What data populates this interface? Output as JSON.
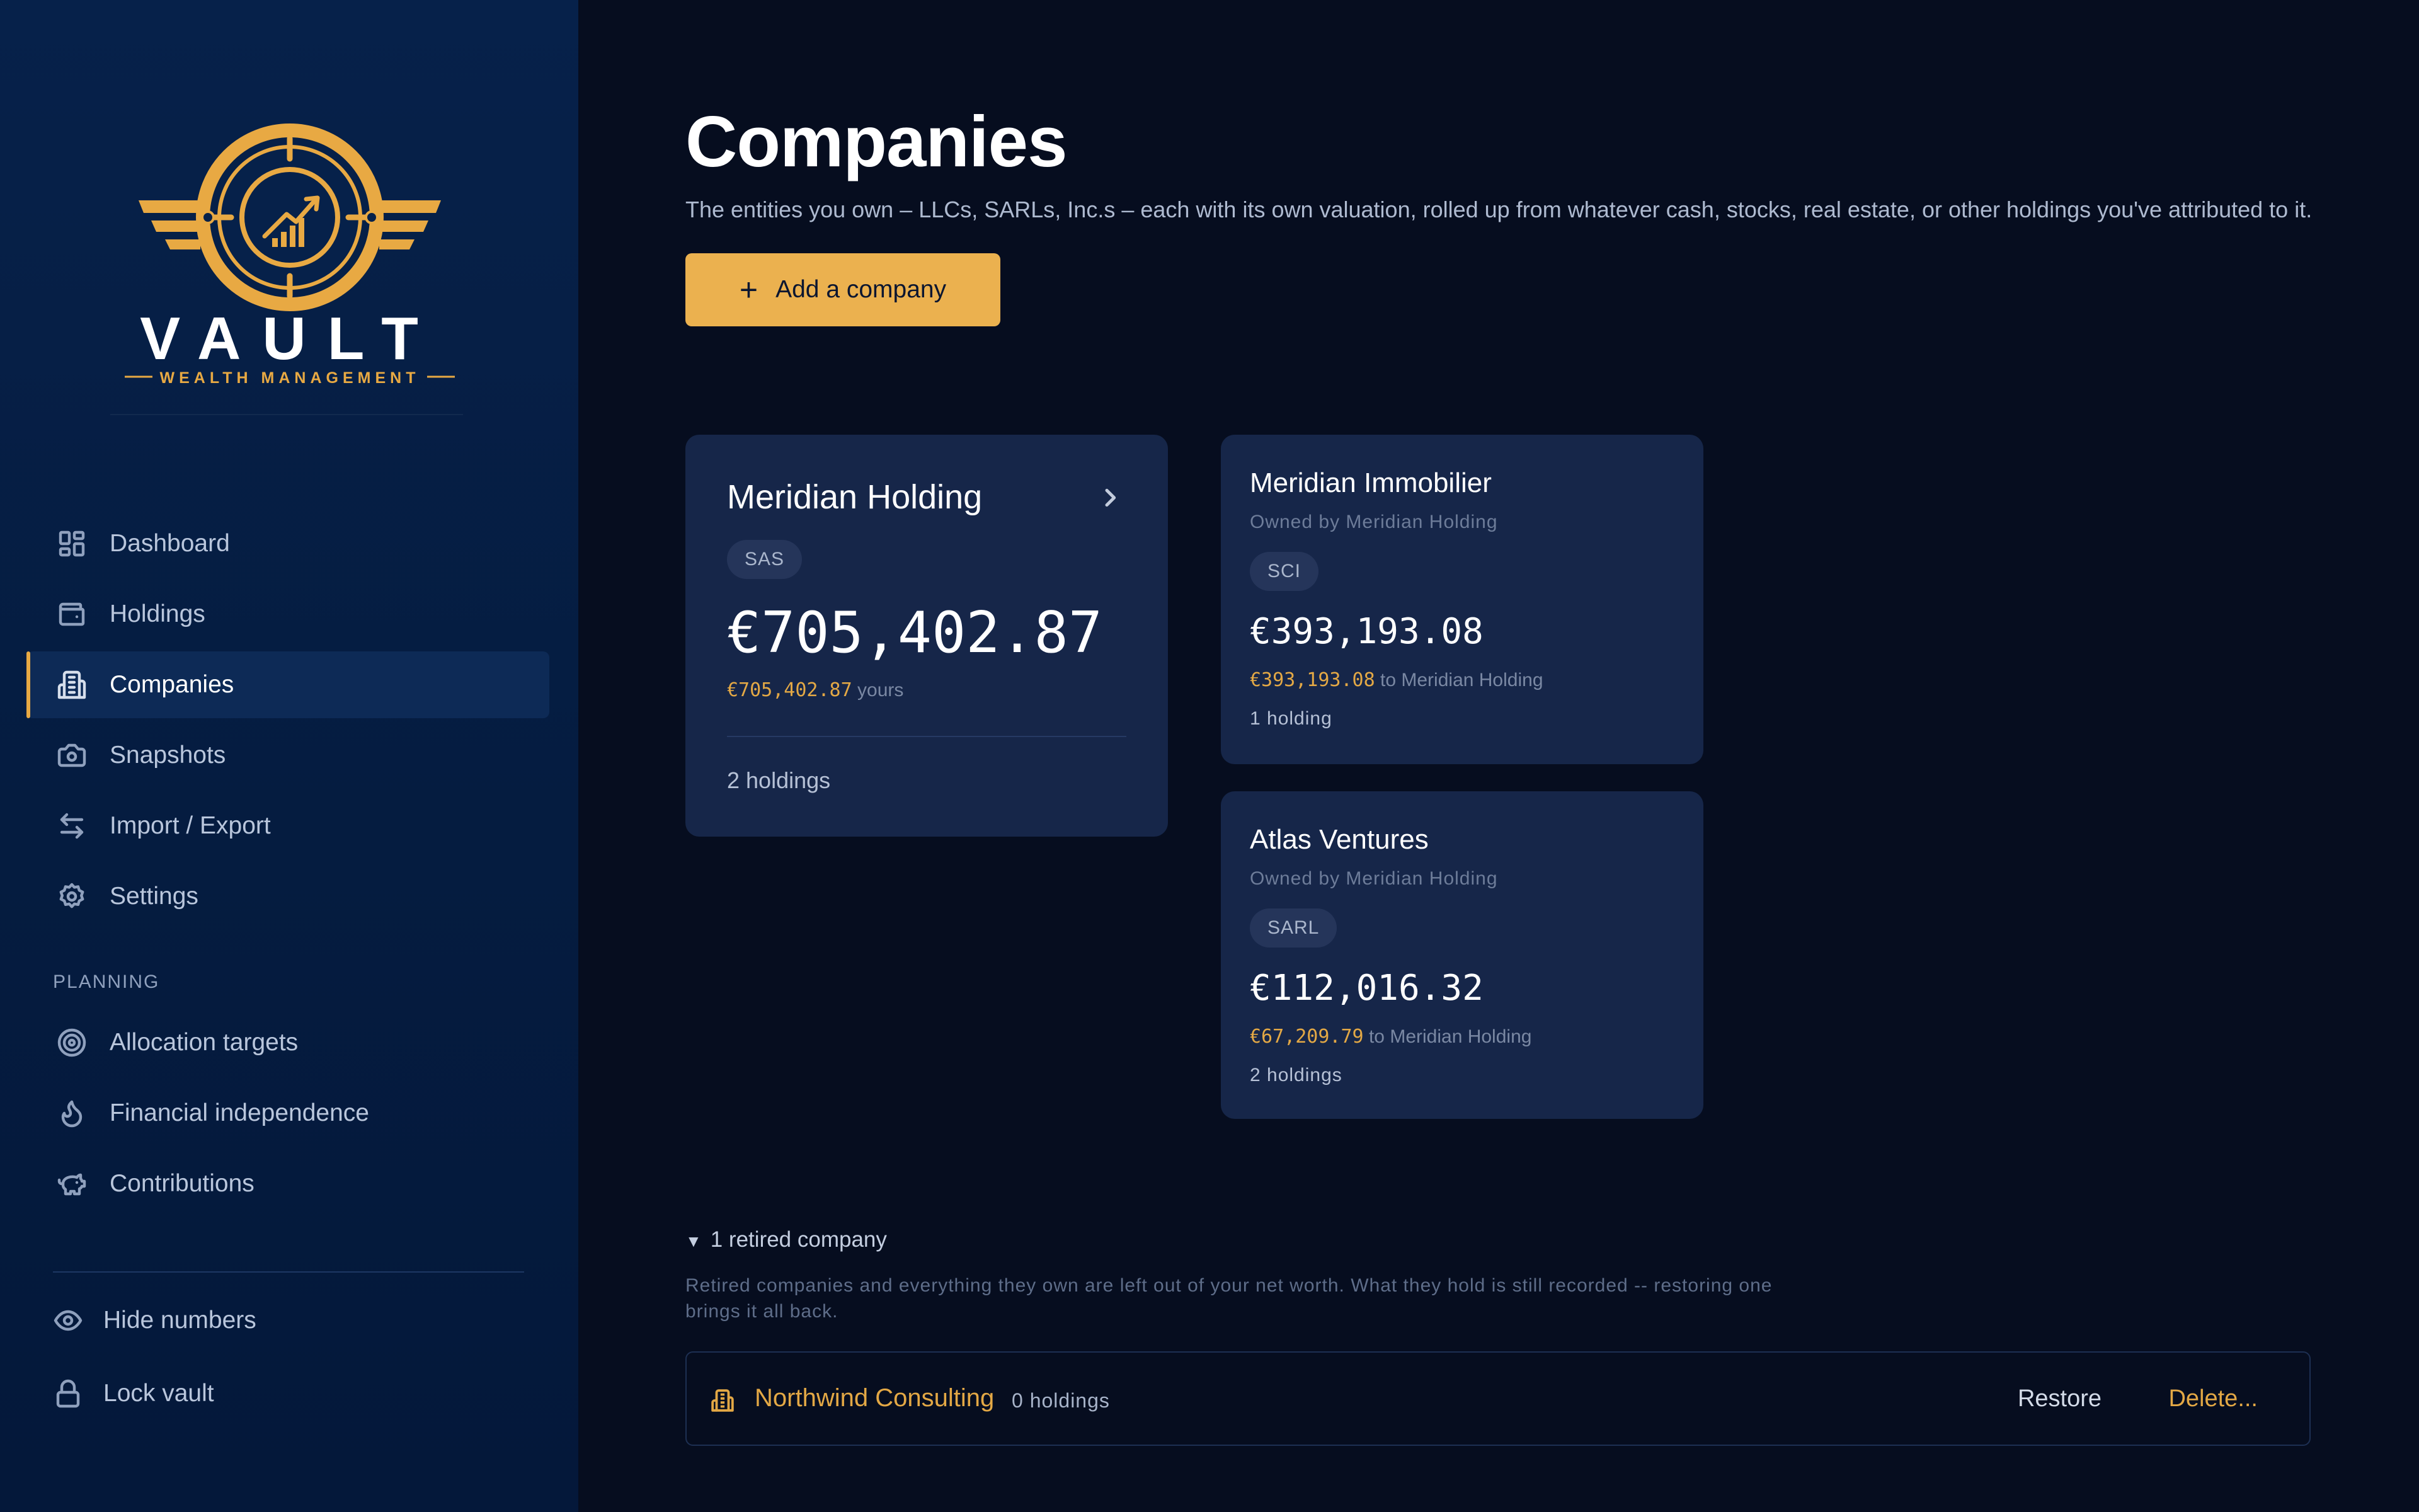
{
  "brand": {
    "name": "VAULT",
    "tagline": "WEALTH MANAGEMENT",
    "accent_color": "#e8a943"
  },
  "sidebar": {
    "items": [
      {
        "label": "Dashboard",
        "icon": "dashboard-icon"
      },
      {
        "label": "Holdings",
        "icon": "wallet-icon"
      },
      {
        "label": "Companies",
        "icon": "building-icon",
        "active": true
      },
      {
        "label": "Snapshots",
        "icon": "camera-icon"
      },
      {
        "label": "Import / Export",
        "icon": "arrows-swap-icon"
      },
      {
        "label": "Settings",
        "icon": "gear-icon"
      }
    ],
    "planning_label": "PLANNING",
    "planning_items": [
      {
        "label": "Allocation targets",
        "icon": "target-icon"
      },
      {
        "label": "Financial independence",
        "icon": "flame-icon"
      },
      {
        "label": "Contributions",
        "icon": "piggy-bank-icon"
      }
    ],
    "hide_numbers": "Hide numbers",
    "lock_vault": "Lock vault"
  },
  "page": {
    "title": "Companies",
    "description": "The entities you own – LLCs, SARLs, Inc.s – each with its own valuation, rolled up from whatever cash, stocks, real estate, or other holdings you've attributed to it.",
    "add_button": "Add a company"
  },
  "companies": {
    "main": {
      "name": "Meridian Holding",
      "type": "SAS",
      "value": "€705,402.87",
      "yours_value": "€705,402.87",
      "yours_label": "yours",
      "holdings": "2 holdings"
    },
    "subs": [
      {
        "name": "Meridian Immobilier",
        "owner": "Owned by Meridian Holding",
        "type": "SCI",
        "value": "€393,193.08",
        "share_value": "€393,193.08",
        "share_label": "to Meridian Holding",
        "holdings": "1 holding"
      },
      {
        "name": "Atlas Ventures",
        "owner": "Owned by Meridian Holding",
        "type": "SARL",
        "value": "€112,016.32",
        "share_value": "€67,209.79",
        "share_label": "to Meridian Holding",
        "holdings": "2 holdings"
      }
    ]
  },
  "retired": {
    "toggle": "1 retired company",
    "note": "Retired companies and everything they own are left out of your net worth. What they hold is still recorded -- restoring one brings it all back.",
    "items": [
      {
        "name": "Northwind Consulting",
        "holdings": "0 holdings",
        "restore": "Restore",
        "delete": "Delete..."
      }
    ]
  }
}
